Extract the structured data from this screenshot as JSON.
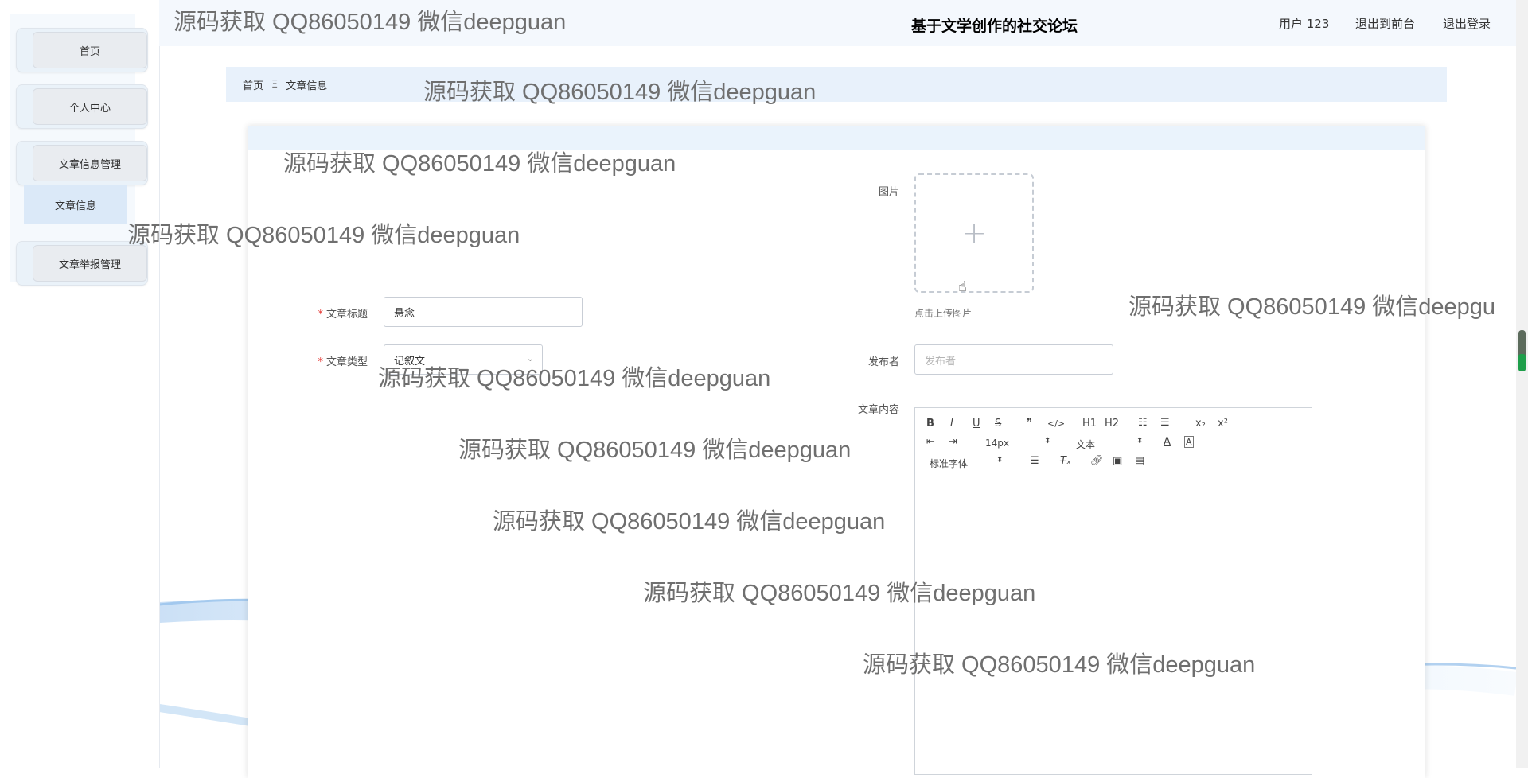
{
  "header": {
    "title": "基于文学创作的社交论坛",
    "user": "用户 123",
    "to_front": "退出到前台",
    "logout": "退出登录"
  },
  "sidebar": {
    "items": [
      {
        "label": "首页"
      },
      {
        "label": "个人中心"
      },
      {
        "label": "文章信息管理"
      },
      {
        "label": "文章举报管理"
      }
    ],
    "submenu": {
      "label": "文章信息"
    }
  },
  "breadcrumb": {
    "home": "首页",
    "separator": "Ξ",
    "current": "文章信息"
  },
  "form": {
    "image_label": "图片",
    "upload_plus": "+",
    "upload_tip": "点击上传图片",
    "required_mark": "*",
    "title_label": "文章标题",
    "title_value": "悬念",
    "type_label": "文章类型",
    "type_value": "记叙文",
    "publisher_label": "发布者",
    "publisher_placeholder": "发布者",
    "content_label": "文章内容"
  },
  "editor": {
    "size_select": "14px",
    "heading_select": "文本",
    "font_select": "标准字体",
    "buttons": [
      "B",
      "I",
      "U",
      "S",
      "❞",
      "</>",
      "H1",
      "H2",
      "☷",
      "☰",
      "x₂",
      "x²"
    ]
  },
  "watermarks": [
    "源码获取 QQ86050149 微信deepguan",
    "源码获取 QQ86050149 微信deepguan",
    "源码获取 QQ86050149 微信deepguan",
    "源码获取 QQ86050149 微信deepguan",
    "源码获取 QQ86050149 微信deepgu",
    "源码获取 QQ86050149 微信deepguan",
    "源码获取 QQ86050149 微信deepguan",
    "源码获取 QQ86050149 微信deepguan",
    "源码获取 QQ86050149 微信deepguan",
    "源码获取 QQ86050149 微信deepguan"
  ],
  "colors": {
    "accent": "#e8f1fb",
    "required": "#e53935",
    "sidebar_active": "#dbe9f8"
  }
}
